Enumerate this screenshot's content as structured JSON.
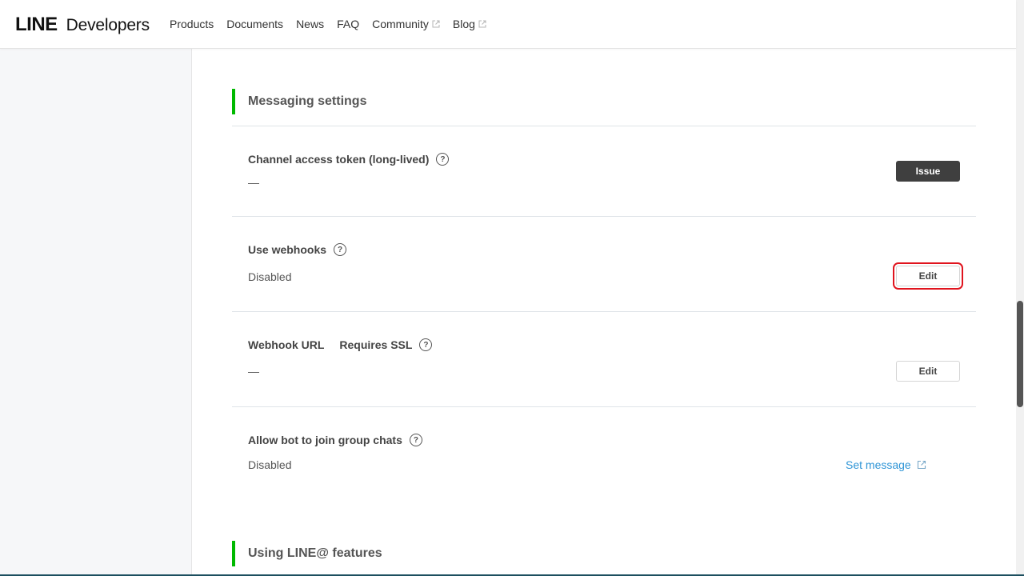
{
  "header": {
    "logo_brand": "LINE",
    "logo_product": "Developers",
    "nav": [
      {
        "label": "Products",
        "external": false
      },
      {
        "label": "Documents",
        "external": false
      },
      {
        "label": "News",
        "external": false
      },
      {
        "label": "FAQ",
        "external": false
      },
      {
        "label": "Community",
        "external": true
      },
      {
        "label": "Blog",
        "external": true
      }
    ]
  },
  "sections": {
    "messaging_title": "Messaging settings",
    "line_at_title": "Using LINE@ features"
  },
  "rows": {
    "access_token": {
      "label": "Channel access token (long-lived)",
      "value": "—",
      "button": "Issue"
    },
    "webhooks": {
      "label": "Use webhooks",
      "value": "Disabled",
      "button": "Edit"
    },
    "webhook_url": {
      "label": "Webhook URL",
      "sublabel": "Requires SSL",
      "value": "—",
      "button": "Edit"
    },
    "group_chats": {
      "label": "Allow bot to join group chats",
      "value": "Disabled",
      "link": "Set message"
    }
  },
  "help_glyph": "?",
  "colors": {
    "accent_green": "#00b900",
    "link_blue": "#2f95d6",
    "highlight_red": "#e0141e"
  }
}
